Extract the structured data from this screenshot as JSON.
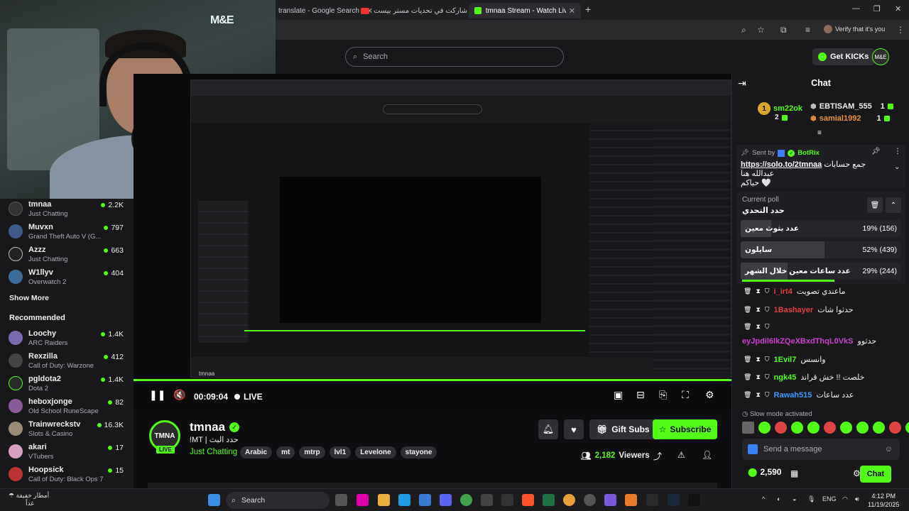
{
  "browser": {
    "tabs": [
      {
        "label": "translate - Google Search",
        "active": false
      },
      {
        "label": "شاركت في تحديات مستر بيست !",
        "active": false
      },
      {
        "label": "tmnaa Stream - Watch Live on K",
        "active": true
      }
    ],
    "profile_label": "Verify that it's you"
  },
  "header": {
    "search_placeholder": "Search",
    "get_kicks_label": "Get KICKs",
    "avatar_text": "M&E"
  },
  "webcam": {
    "overlay_logo": "M&E"
  },
  "sidebar": {
    "following": [
      {
        "name": "tmnaa",
        "sub": "Just Chatting",
        "count": "2.2K"
      },
      {
        "name": "Muvxn",
        "sub": "Grand Theft Auto V (G...",
        "count": "797"
      },
      {
        "name": "Azzz",
        "sub": "Just Chatting",
        "count": "663"
      },
      {
        "name": "W1llyv",
        "sub": "Overwatch 2",
        "count": "404"
      }
    ],
    "show_more": "Show More",
    "recommended_title": "Recommended",
    "recommended": [
      {
        "name": "Loochy",
        "sub": "ARC Raiders",
        "count": "1.4K"
      },
      {
        "name": "Rexzilla",
        "sub": "Call of Duty: Warzone",
        "count": "412"
      },
      {
        "name": "pgldota2",
        "sub": "Dota 2",
        "count": "1.4K"
      },
      {
        "name": "heboxjonge",
        "sub": "Old School RuneScape",
        "count": "82"
      },
      {
        "name": "Trainwreckstv",
        "sub": "Slots & Casino",
        "count": "16.3K"
      },
      {
        "name": "akari",
        "sub": "VTubers",
        "count": "17"
      },
      {
        "name": "Hoopsick",
        "sub": "Call of Duty: Black Ops 7",
        "count": "15"
      }
    ]
  },
  "player": {
    "time": "00:09:04",
    "live_label": "LIVE",
    "pip_name": "tmnaa"
  },
  "stream": {
    "avatar_text": "TMNA",
    "live_badge": "LIVE",
    "name": "tmnaa",
    "title": "!MT | حدد البث",
    "category": "Just Chatting",
    "tags": [
      "Arabic",
      "mt",
      "mtrp",
      "lvl1",
      "Levelone",
      "stayone"
    ],
    "gift_subs_label": "Gift Subs",
    "subscribe_label": "Subscribe",
    "viewers_count": "2,182",
    "viewers_label": "Viewers"
  },
  "chat": {
    "title": "Chat",
    "gifters": [
      {
        "name": "sm22ok",
        "count": "2"
      },
      {
        "name": "EBTISAM_555",
        "count": "1"
      },
      {
        "name": "samial1992",
        "count": "1"
      }
    ],
    "pinned": {
      "sent_by_label": "Sent by",
      "sender": "BotRix",
      "message_arabic": "جمع حسابات عبدالله هنا",
      "link": "https://solo.to/2tmnaa",
      "message_tail": "حياكم 🤍"
    },
    "poll": {
      "header": "Current poll",
      "question": "حدد التحدي",
      "options": [
        {
          "label": "عدد بثوث معين",
          "pct": "19% (156)",
          "fraction": 0.19
        },
        {
          "label": "سايلون",
          "pct": "52% (439)",
          "fraction": 0.52
        },
        {
          "label": "عدد ساعات معين خلال الشهر",
          "pct": "29% (244)",
          "fraction": 0.29
        }
      ]
    },
    "messages": [
      {
        "user": "i_irt4",
        "text": "ماعندي تصويت",
        "color": "#e04040"
      },
      {
        "user": "1Bashayer",
        "text": "حدثوا شات",
        "color": "#e04040"
      },
      {
        "user": "",
        "text": "",
        "color": "#fff"
      },
      {
        "user": "eyJpdil6lkZQeXBxdThqL0VkS",
        "text": "حدثوو",
        "color": "#d23ed2"
      },
      {
        "user": "1Evil7",
        "text": "وانسس",
        "color": "#53fc18"
      },
      {
        "user": "ngk45",
        "text": "خلصت !! خش قراند",
        "color": "#53fc18"
      },
      {
        "user": "Rawah515",
        "text": "عدد ساعات",
        "color": "#3b9cff"
      }
    ],
    "slow_mode": "Slow mode activated",
    "send_placeholder": "Send a message",
    "points": "2,590",
    "chat_button": "Chat"
  },
  "taskbar": {
    "weather_line1": "أمطار خفيفة",
    "weather_line2": "غداً",
    "search_label": "Search",
    "lang": "ENG",
    "time": "4:12 PM",
    "date": "11/19/2025"
  }
}
